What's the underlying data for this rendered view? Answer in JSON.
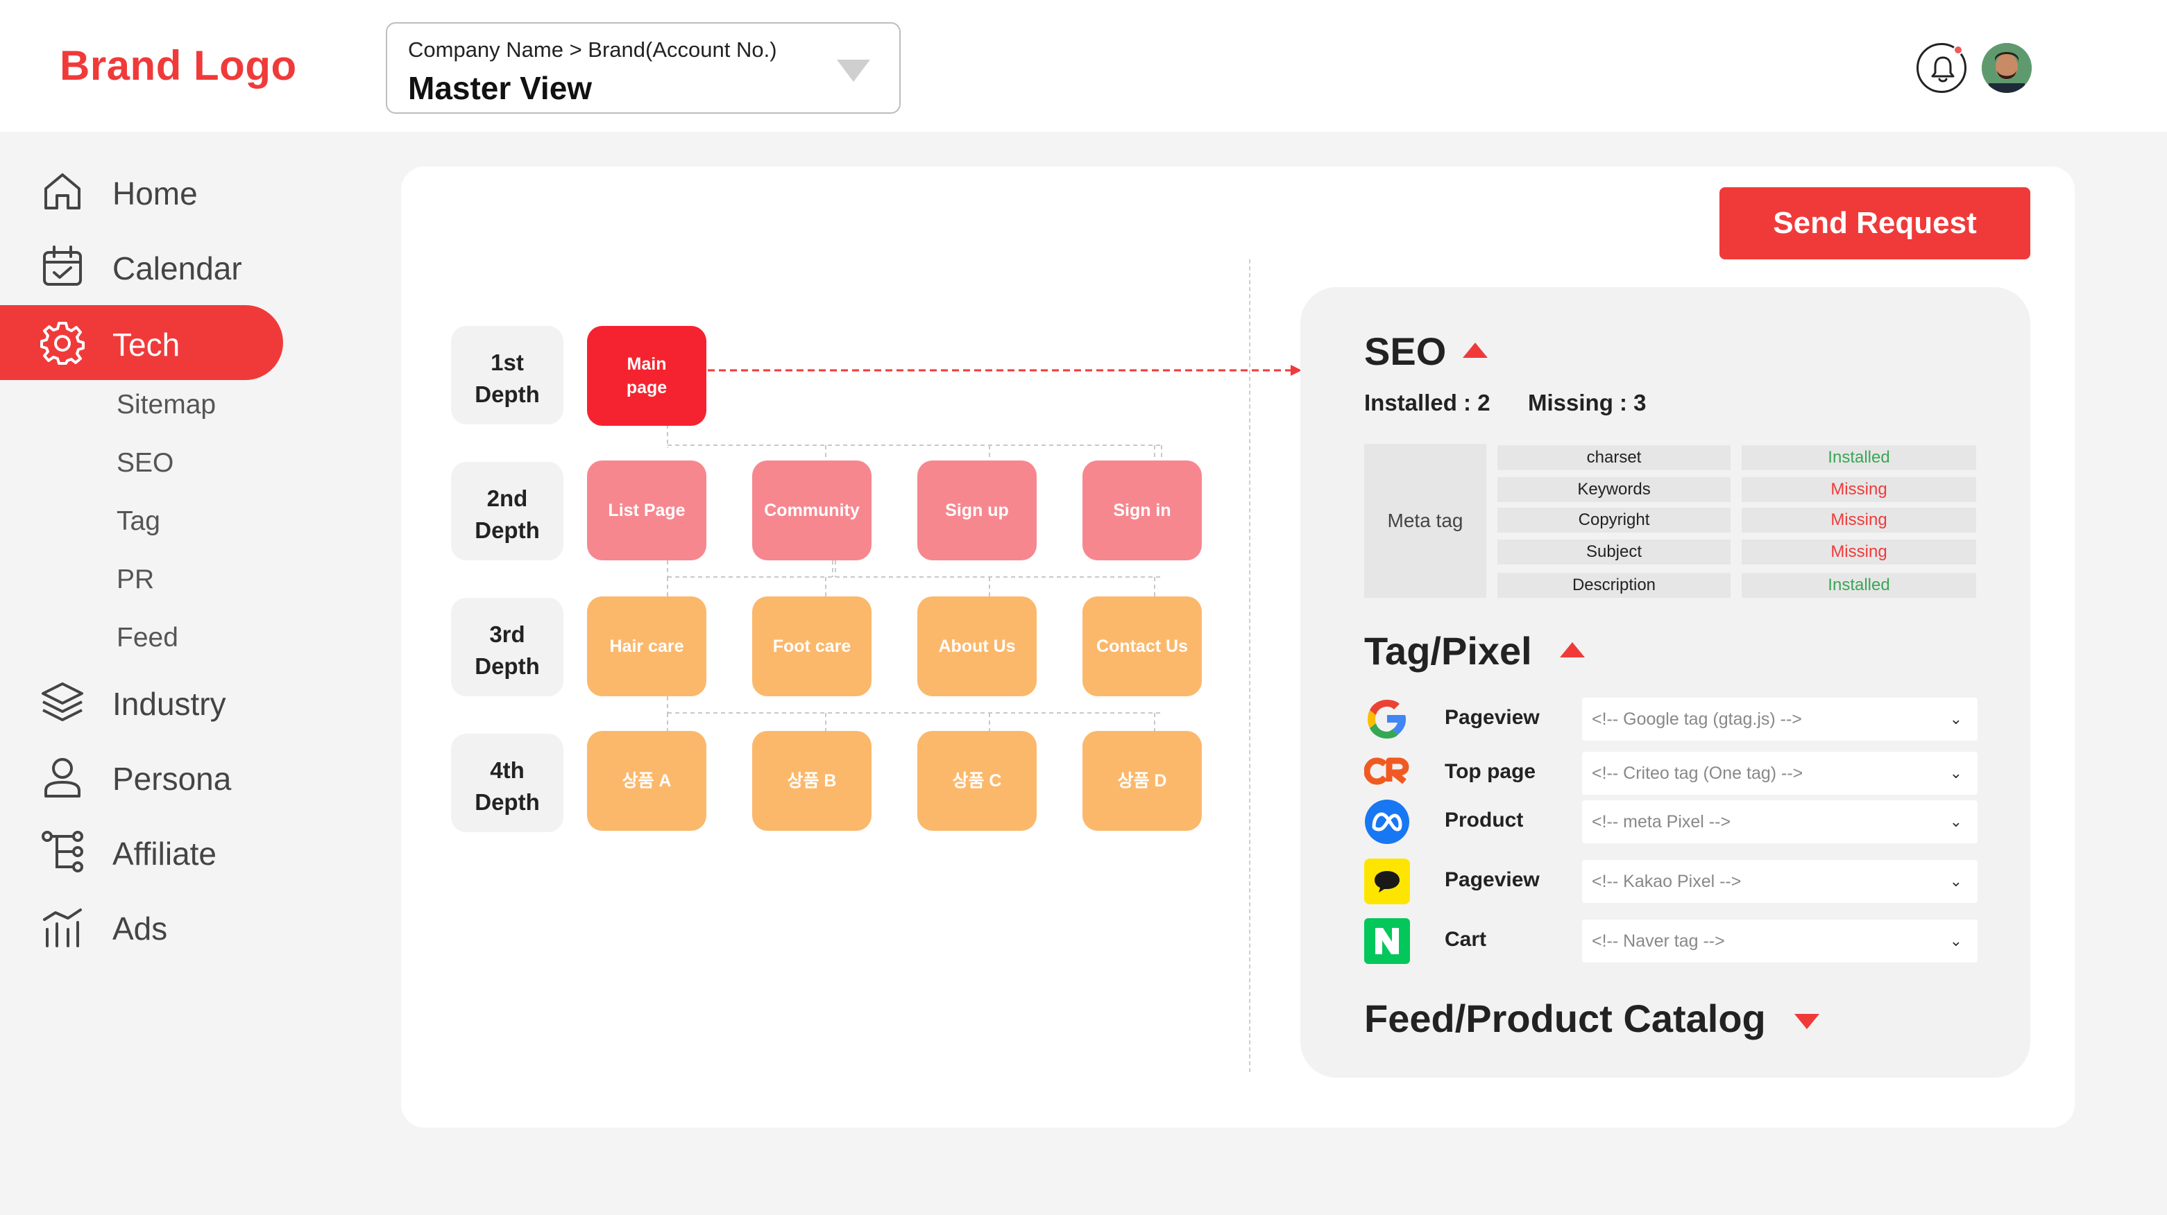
{
  "header": {
    "brand_logo": "Brand Logo",
    "account_path": "Company Name > Brand(Account No.)",
    "account_view": "Master View"
  },
  "sidebar": {
    "items": [
      {
        "label": "Home",
        "icon": "home-icon"
      },
      {
        "label": "Calendar",
        "icon": "calendar-icon"
      },
      {
        "label": "Tech",
        "icon": "gear-icon",
        "active": true
      },
      {
        "label": "Industry",
        "icon": "layers-icon"
      },
      {
        "label": "Persona",
        "icon": "user-icon"
      },
      {
        "label": "Affiliate",
        "icon": "tree-icon"
      },
      {
        "label": "Ads",
        "icon": "ads-icon"
      }
    ],
    "sub_items": [
      "Sitemap",
      "SEO",
      "Tag",
      "PR",
      "Feed"
    ]
  },
  "actions": {
    "send_request": "Send Request"
  },
  "sitemap": {
    "depths": [
      {
        "line1": "1st",
        "line2": "Depth"
      },
      {
        "line1": "2nd",
        "line2": "Depth"
      },
      {
        "line1": "3rd",
        "line2": "Depth"
      },
      {
        "line1": "4th",
        "line2": "Depth"
      }
    ],
    "main_page": {
      "line1": "Main",
      "line2": "page"
    },
    "depth2": [
      "List Page",
      "Community",
      "Sign up",
      "Sign in"
    ],
    "depth3": [
      "Hair care",
      "Foot care",
      "About Us",
      "Contact Us"
    ],
    "depth4": [
      "상품 A",
      "상품 B",
      "상품 C",
      "상품 D"
    ]
  },
  "seo": {
    "title": "SEO",
    "installed": "Installed : 2",
    "missing": "Missing : 3",
    "meta_label": "Meta tag",
    "rows": [
      {
        "key": "charset",
        "status": "Installed"
      },
      {
        "key": "Keywords",
        "status": "Missing"
      },
      {
        "key": "Copyright",
        "status": "Missing"
      },
      {
        "key": "Subject",
        "status": "Missing"
      },
      {
        "key": "Description",
        "status": "Installed"
      }
    ]
  },
  "tag_pixel": {
    "title": "Tag/Pixel",
    "rows": [
      {
        "logo": "google-logo-icon",
        "event": "Pageview",
        "tag": "<!-- Google tag (gtag.js) -->"
      },
      {
        "logo": "criteo-logo-icon",
        "event": "Top page",
        "tag": "<!-- Criteo tag (One tag) -->"
      },
      {
        "logo": "meta-logo-icon",
        "event": "Product",
        "tag": "<!-- meta Pixel -->"
      },
      {
        "logo": "kakao-logo-icon",
        "event": "Pageview",
        "tag": "<!-- Kakao Pixel -->"
      },
      {
        "logo": "naver-logo-icon",
        "event": "Cart",
        "tag": "<!-- Naver tag -->"
      }
    ]
  },
  "feed": {
    "title": "Feed/Product Catalog"
  },
  "colors": {
    "accent": "#f03a3a",
    "depth1": "#f5232f",
    "depth2": "#f7878f",
    "depth3": "#fbb86b",
    "installed": "#3aa655",
    "missing": "#f03a3a"
  }
}
